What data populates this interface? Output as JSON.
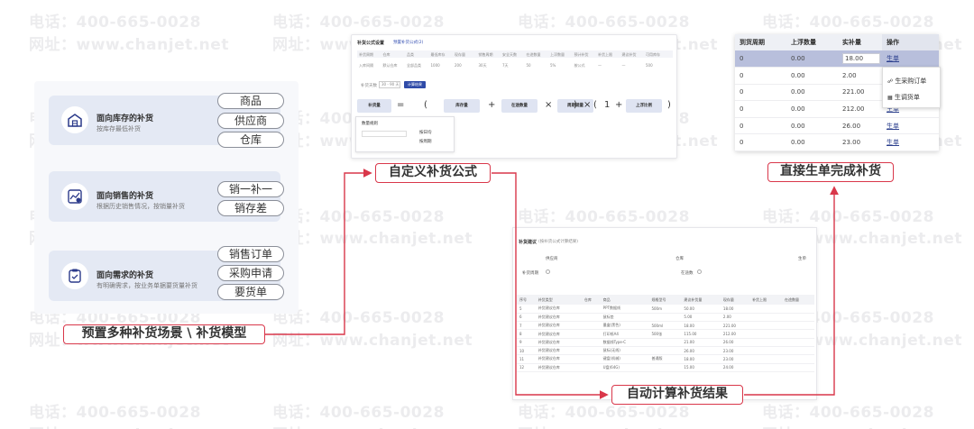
{
  "watermark": {
    "phone": "电话：400-665-0028",
    "site": "网址：www.chanjet.net"
  },
  "scenarios": [
    {
      "title": "面向库存的补货",
      "desc": "按库存最低补货",
      "icon": "warehouse-icon",
      "options": [
        "商品",
        "供应商",
        "仓库"
      ]
    },
    {
      "title": "面向销售的补货",
      "desc": "根据历史销售情况，按销量补货",
      "icon": "sales-chart-icon",
      "options": [
        "销一补一",
        "销存差"
      ]
    },
    {
      "title": "面向需求的补货",
      "desc": "有明确需求，按业务单据要货量补货",
      "icon": "clipboard-icon",
      "options": [
        "销售订单",
        "采购申请",
        "要货单"
      ]
    }
  ],
  "labels": {
    "preset": "预置多种补货场景 \\ 补货模型",
    "custom": "自定义补货公式",
    "auto": "自动计算补货结果",
    "direct": "直接生单完成补货"
  },
  "formula": {
    "title": "补货公式设置",
    "subtitle": "预置补货公式(2)",
    "header_cols": [
      "补货周期",
      "仓库",
      "品类",
      "最低库存",
      "现存量",
      "销售周期",
      "安全天数",
      "在途数量",
      "上浮数量",
      "预计补货",
      "补货上限",
      "建议补货",
      "可用库存"
    ],
    "row_cells": [
      "入库间隔",
      "默认仓库",
      "全部品类",
      "1000",
      "200",
      "30天",
      "7天",
      "50",
      "5%",
      "按公式",
      "—",
      "—",
      "500"
    ],
    "param_label": "补货天数",
    "param_value": "30 - 90 天",
    "calc_button": "计算结果",
    "items": [
      "补货量",
      "=",
      "(",
      "库存量",
      "+",
      "在途数量",
      "×",
      "周期销量",
      ")",
      "×",
      "(",
      "1",
      "+",
      "上浮比例",
      ")"
    ],
    "tip_title": "数量规则",
    "opt1": "按日均",
    "opt2": "按周期"
  },
  "result": {
    "title": "补货建议",
    "subtitle": "(按补货公式计算结果)",
    "field1": "供应商",
    "field2": "仓库",
    "field3": "补货周期",
    "field4": "在途数",
    "action": "生单",
    "headers": [
      "序号",
      "补货类型",
      "仓库",
      "商品",
      "规格型号",
      "建议补货量",
      "现存量",
      "补货上限",
      "在途数量"
    ],
    "rows": [
      [
        "5",
        "补货建议仓库",
        "",
        "PPT数据线",
        "500m",
        "50.00",
        "18.00",
        "",
        ""
      ],
      [
        "6",
        "补货建议仓库",
        "",
        "鼠标垫",
        "",
        "5.00",
        "2.00",
        "",
        ""
      ],
      [
        "7",
        "补货建议仓库",
        "",
        "墨盒(黑色)",
        "500ml",
        "18.00",
        "221.00",
        "",
        ""
      ],
      [
        "8",
        "补货建议仓库",
        "",
        "打印纸A4",
        "500张",
        "115.00",
        "212.00",
        "",
        ""
      ],
      [
        "9",
        "补货建议仓库",
        "",
        "数据线Type-C",
        "",
        "21.00",
        "26.00",
        "",
        ""
      ],
      [
        "10",
        "补货建议仓库",
        "",
        "鼠标(无线)",
        "",
        "26.00",
        "23.00",
        "",
        ""
      ],
      [
        "11",
        "补货建议仓库",
        "",
        "键盘(机械)",
        "普通版",
        "18.00",
        "23.00",
        "",
        ""
      ],
      [
        "12",
        "补货建议仓库",
        "",
        "U盘(64G)",
        "",
        "15.00",
        "24.00",
        "",
        ""
      ]
    ]
  },
  "orders": {
    "headers": [
      "到货周期",
      "上浮数量",
      "实补量",
      "操作"
    ],
    "rows": [
      {
        "c1": "0",
        "c2": "0.00",
        "c3": "18.00",
        "op": "生单"
      },
      {
        "c1": "0",
        "c2": "0.00",
        "c3": "2.00",
        "op": ""
      },
      {
        "c1": "0",
        "c2": "0.00",
        "c3": "221.00",
        "op": ""
      },
      {
        "c1": "0",
        "c2": "0.00",
        "c3": "212.00",
        "op": "生单"
      },
      {
        "c1": "0",
        "c2": "0.00",
        "c3": "26.00",
        "op": "生单"
      },
      {
        "c1": "0",
        "c2": "0.00",
        "c3": "23.00",
        "op": "生单"
      }
    ],
    "menu": [
      "生采购订单",
      "生调货单"
    ]
  }
}
